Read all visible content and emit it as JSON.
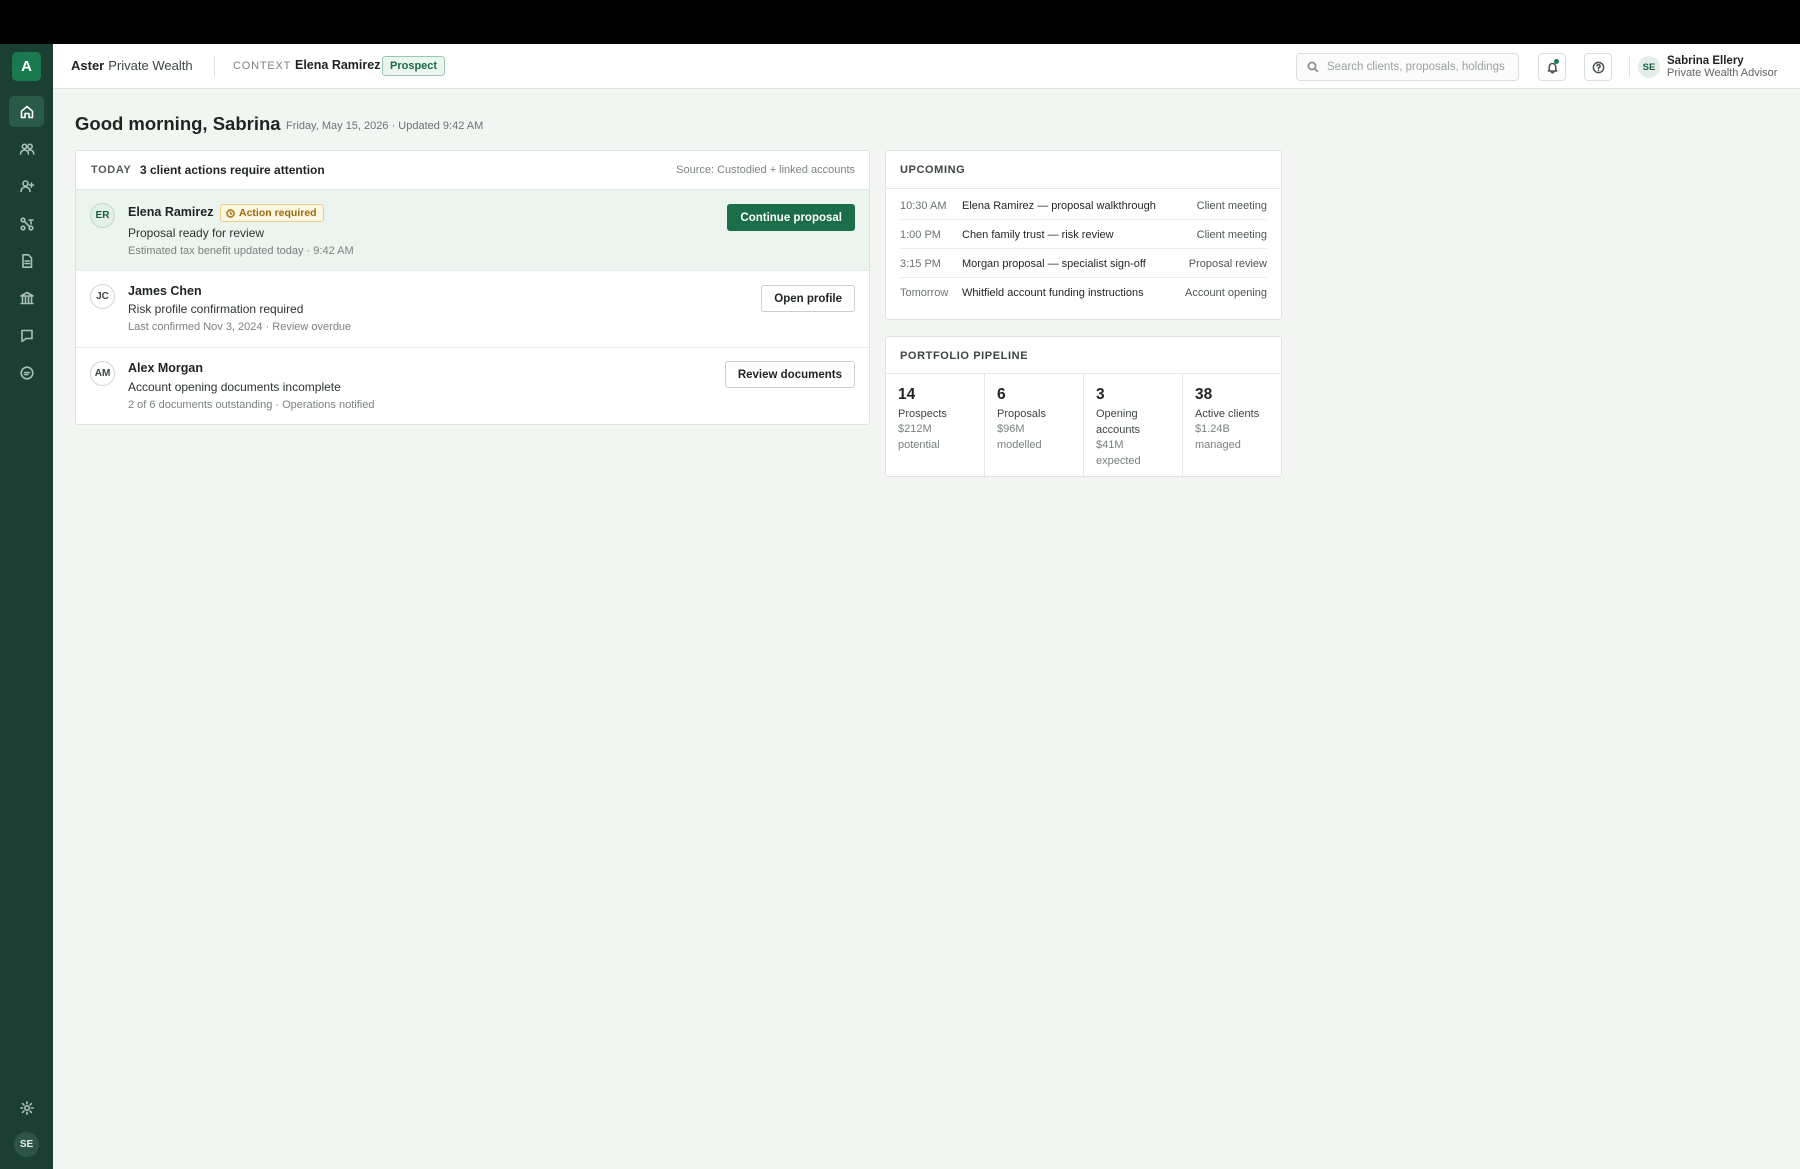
{
  "sidebar": {
    "logo": "A",
    "items": [
      {
        "name": "home-icon",
        "active": true
      },
      {
        "name": "clients-icon",
        "active": false
      },
      {
        "name": "add-client-icon",
        "active": false
      },
      {
        "name": "workflow-icon",
        "active": false
      },
      {
        "name": "documents-icon",
        "active": false
      },
      {
        "name": "institution-icon",
        "active": false
      },
      {
        "name": "notes-icon",
        "active": false
      },
      {
        "name": "messages-icon",
        "active": false
      }
    ],
    "settings_icon": "gear-icon",
    "avatar": "SE"
  },
  "header": {
    "brand_name": "Aster",
    "brand_suffix": "Private Wealth",
    "context_label": "CONTEXT",
    "context_client": "Elena Ramirez",
    "context_badge": "Prospect",
    "search_placeholder": "Search clients, proposals, holdings",
    "user_initials": "SE",
    "user_name": "Sabrina Ellery",
    "user_role": "Private Wealth Advisor"
  },
  "main": {
    "greeting": "Good morning, Sabrina",
    "greeting_meta": "Friday, May 15, 2026 · Updated 9:42 AM",
    "actions": {
      "label": "TODAY",
      "summary": "3 client actions require attention",
      "source": "Source: Custodied + linked accounts",
      "rows": [
        {
          "initials": "ER",
          "name": "Elena Ramirez",
          "badge": "Action required",
          "desc": "Proposal ready for review",
          "meta": "Estimated tax benefit updated today · 9:42 AM",
          "button": "Continue proposal"
        },
        {
          "initials": "JC",
          "name": "James Chen",
          "desc": "Risk profile confirmation required",
          "meta": "Last confirmed Nov 3, 2024 · Review overdue",
          "button": "Open profile"
        },
        {
          "initials": "AM",
          "name": "Alex Morgan",
          "desc": "Account opening documents incomplete",
          "meta": "2 of 6 documents outstanding · Operations notified",
          "button": "Review documents"
        }
      ]
    },
    "upcoming": {
      "title": "UPCOMING",
      "rows": [
        {
          "time": "10:30 AM",
          "title": "Elena Ramirez — proposal walkthrough",
          "type": "Client meeting"
        },
        {
          "time": "1:00 PM",
          "title": "Chen family trust — risk review",
          "type": "Client meeting"
        },
        {
          "time": "3:15 PM",
          "title": "Morgan proposal — specialist sign-off",
          "type": "Proposal review"
        },
        {
          "time": "Tomorrow",
          "title": "Whitfield account funding instructions",
          "type": "Account opening"
        }
      ]
    },
    "pipeline": {
      "title": "PORTFOLIO PIPELINE",
      "cells": [
        {
          "count": "14",
          "label": "Prospects",
          "amount": "$212M",
          "note": "potential"
        },
        {
          "count": "6",
          "label": "Proposals",
          "amount": "$96M",
          "note": "modelled"
        },
        {
          "count": "3",
          "label": "Opening accounts",
          "amount": "$41M",
          "note": "expected"
        },
        {
          "count": "38",
          "label": "Active clients",
          "amount": "$1.24B",
          "note": "managed"
        }
      ]
    }
  }
}
